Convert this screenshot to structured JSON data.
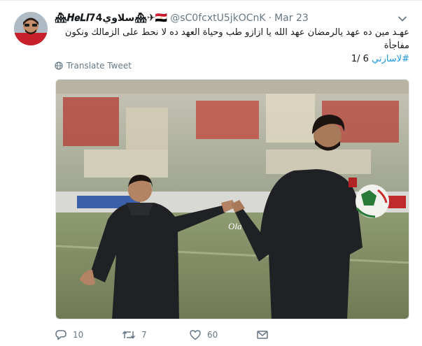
{
  "tweet": {
    "display_name": "🏘𝑯𝒆𝑳𝒍74سلاوي🏘✈🇪🇬",
    "screen_name": "@sC0fcxtU5jkOCnK",
    "separator": "·",
    "time": "Mar 23",
    "text_line1": "عهـد مين ده عهد يالرمضان عهد الله يا ازازو طب وحياة العهد ده لا نحط على الزمالك ونكون مفاجأة",
    "hashtag": "#لاسارتي",
    "text_suffix": "6 /1",
    "translate_label": "Translate Tweet",
    "watermark": "Ola",
    "reply_count": "10",
    "retweet_count": "7",
    "like_count": "60"
  },
  "icons": {
    "caret": "chevron-down-icon",
    "translate": "globe-icon",
    "reply": "reply-icon",
    "retweet": "retweet-icon",
    "like": "heart-icon",
    "dm": "envelope-icon"
  },
  "colors": {
    "link": "#1b95e0",
    "secondary_text": "#657786",
    "primary_text": "#14171a"
  }
}
